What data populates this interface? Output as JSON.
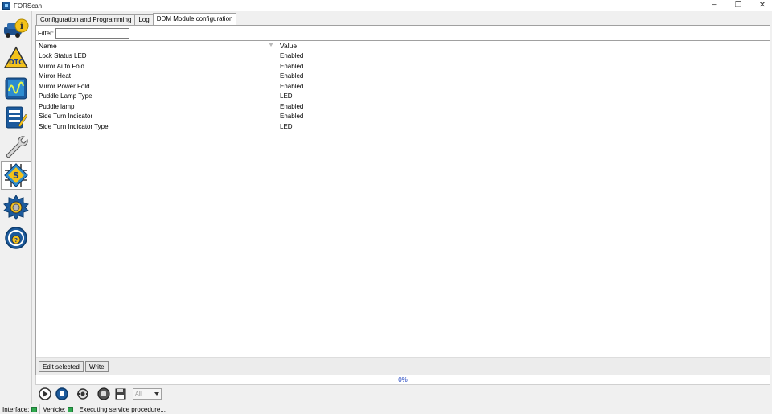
{
  "window": {
    "title": "FORScan",
    "minimize": "−",
    "maximize": "❐",
    "close": "✕"
  },
  "sidebar": {
    "items": [
      {
        "name": "vehicle-info-icon",
        "label": "i"
      },
      {
        "name": "dtc-icon",
        "label": "DTC"
      },
      {
        "name": "oscilloscope-icon",
        "label": ""
      },
      {
        "name": "checklist-icon",
        "label": ""
      },
      {
        "name": "wrench-icon",
        "label": ""
      },
      {
        "name": "module-config-icon",
        "label": "S"
      },
      {
        "name": "settings-gear-icon",
        "label": ""
      },
      {
        "name": "help-steering-icon",
        "label": "?"
      }
    ]
  },
  "tabs": [
    {
      "label": "Configuration and Programming"
    },
    {
      "label": "Log"
    },
    {
      "label": "DDM Module configuration"
    }
  ],
  "filter": {
    "label": "Filter:",
    "value": ""
  },
  "grid": {
    "columns": [
      "Name",
      "Value"
    ],
    "rows": [
      {
        "name": "Lock Status LED",
        "value": "Enabled"
      },
      {
        "name": "Mirror Auto Fold",
        "value": "Enabled"
      },
      {
        "name": "Mirror Heat",
        "value": "Enabled"
      },
      {
        "name": "Mirror Power Fold",
        "value": "Enabled"
      },
      {
        "name": "Puddle Lamp Type",
        "value": "LED"
      },
      {
        "name": "Puddle lamp",
        "value": "Enabled"
      },
      {
        "name": "Side Turn Indicator",
        "value": "Enabled"
      },
      {
        "name": "Side Turn Indicator Type",
        "value": "LED"
      }
    ]
  },
  "buttons": {
    "edit_selected": "Edit selected",
    "write": "Write"
  },
  "progress": {
    "value": "0%"
  },
  "toolbar": {
    "select_value": "All"
  },
  "status": {
    "interface_label": "Interface:",
    "vehicle_label": "Vehicle:",
    "message": "Executing service procedure..."
  },
  "colors": {
    "accent_blue": "#1c5a9c",
    "status_green": "#2fa84f",
    "progress_text": "#1a3fbf"
  }
}
